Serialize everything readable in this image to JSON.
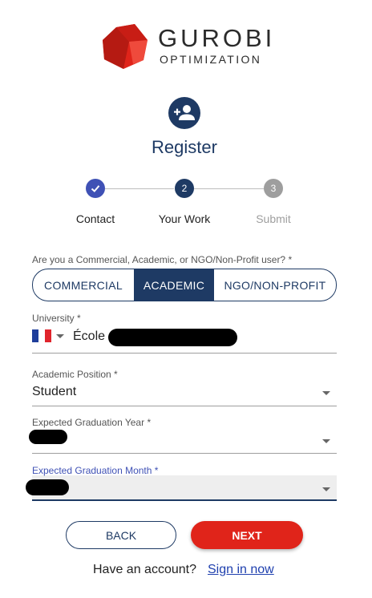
{
  "brand": {
    "name": "GUROBI",
    "sub": "OPTIMIZATION",
    "logo_icon": "gurobi-cube-icon"
  },
  "header": {
    "icon": "person-add-icon",
    "title": "Register"
  },
  "stepper": {
    "steps": [
      {
        "label": "Contact",
        "number": "",
        "status": "done"
      },
      {
        "label": "Your Work",
        "number": "2",
        "status": "active"
      },
      {
        "label": "Submit",
        "number": "3",
        "status": "pending"
      }
    ]
  },
  "user_type": {
    "question": "Are you a Commercial, Academic, or NGO/Non-Profit user? *",
    "options": [
      "COMMERCIAL",
      "ACADEMIC",
      "NGO/NON-PROFIT"
    ],
    "selected": "ACADEMIC"
  },
  "fields": {
    "university": {
      "label": "University *",
      "value": "École",
      "flag": "France"
    },
    "position": {
      "label": "Academic Position *",
      "value": "Student"
    },
    "grad_year": {
      "label": "Expected Graduation Year *",
      "value": ""
    },
    "grad_month": {
      "label": "Expected Graduation Month *",
      "value": ""
    }
  },
  "actions": {
    "back": "BACK",
    "next": "NEXT"
  },
  "footer": {
    "prompt": "Have an account?",
    "link": "Sign in now"
  },
  "colors": {
    "navy": "#1e3a64",
    "red": "#e0241a",
    "step_done": "#3f51b5",
    "step_pending": "#9e9e9e"
  }
}
